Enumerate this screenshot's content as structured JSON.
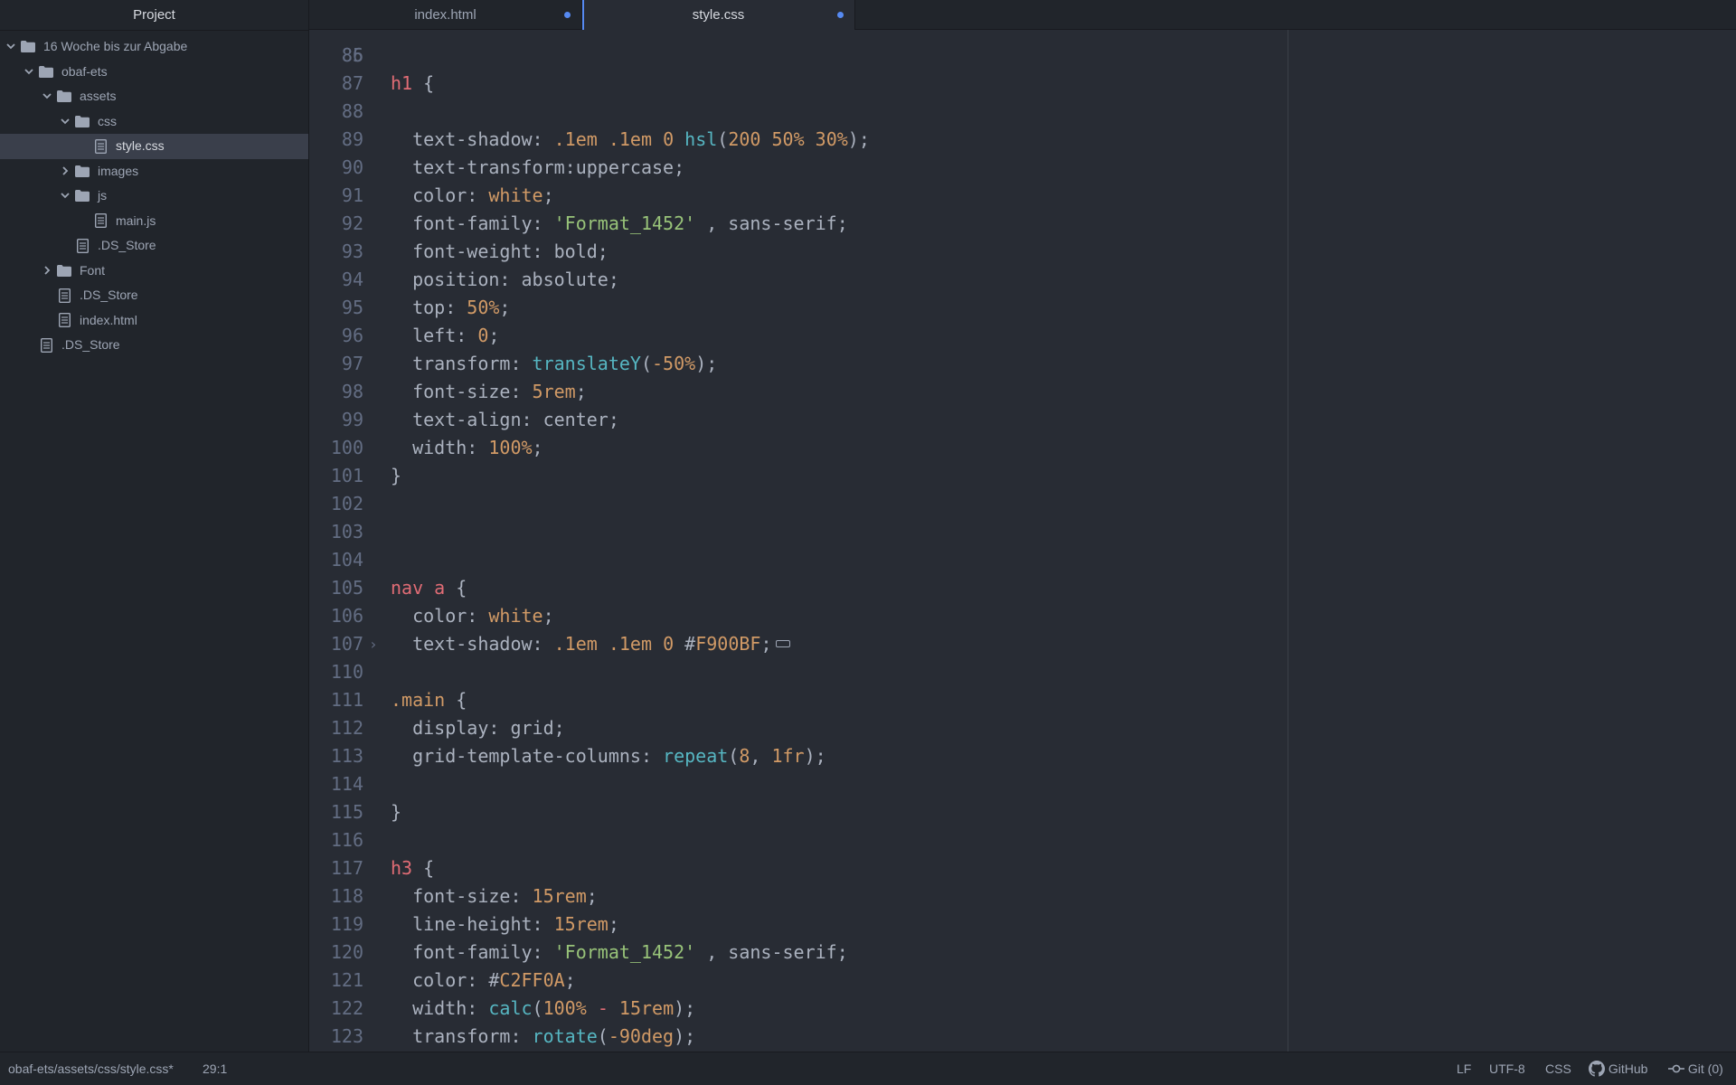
{
  "sidebar": {
    "title": "Project",
    "tree": [
      {
        "label": "16 Woche bis zur Abgabe",
        "type": "folder",
        "expanded": true,
        "depth": 0
      },
      {
        "label": "obaf-ets",
        "type": "folder",
        "expanded": true,
        "depth": 1
      },
      {
        "label": "assets",
        "type": "folder",
        "expanded": true,
        "depth": 2
      },
      {
        "label": "css",
        "type": "folder",
        "expanded": true,
        "depth": 3
      },
      {
        "label": "style.css",
        "type": "file",
        "depth": 4,
        "selected": true
      },
      {
        "label": "images",
        "type": "folder",
        "expanded": false,
        "depth": 3
      },
      {
        "label": "js",
        "type": "folder",
        "expanded": true,
        "depth": 3
      },
      {
        "label": "main.js",
        "type": "file",
        "depth": 4
      },
      {
        "label": ".DS_Store",
        "type": "file",
        "depth": 3
      },
      {
        "label": "Font",
        "type": "folder",
        "expanded": false,
        "depth": 2
      },
      {
        "label": ".DS_Store",
        "type": "file",
        "depth": 2
      },
      {
        "label": "index.html",
        "type": "file",
        "depth": 2
      },
      {
        "label": ".DS_Store",
        "type": "file",
        "depth": 1
      }
    ]
  },
  "tabs": [
    {
      "label": "index.html",
      "active": false,
      "modified": true
    },
    {
      "label": "style.css",
      "active": true,
      "modified": true
    }
  ],
  "editor": {
    "first_partial_line": "85",
    "lines": [
      {
        "n": "86",
        "tokens": []
      },
      {
        "n": "87",
        "tokens": [
          [
            "k",
            "h1"
          ],
          [
            "p",
            " {"
          ]
        ]
      },
      {
        "n": "88",
        "tokens": []
      },
      {
        "n": "89",
        "tokens": [
          [
            "p",
            "  text-shadow: "
          ],
          [
            "n",
            ".1em"
          ],
          [
            "p",
            " "
          ],
          [
            "n",
            ".1em"
          ],
          [
            "p",
            " "
          ],
          [
            "n",
            "0"
          ],
          [
            "p",
            " "
          ],
          [
            "f",
            "hsl"
          ],
          [
            "p",
            "("
          ],
          [
            "n",
            "200"
          ],
          [
            "p",
            " "
          ],
          [
            "n",
            "50%"
          ],
          [
            "p",
            " "
          ],
          [
            "n",
            "30%"
          ],
          [
            "p",
            ");"
          ]
        ]
      },
      {
        "n": "90",
        "tokens": [
          [
            "p",
            "  text-transform:uppercase;"
          ]
        ]
      },
      {
        "n": "91",
        "tokens": [
          [
            "p",
            "  color: "
          ],
          [
            "c",
            "white"
          ],
          [
            "p",
            ";"
          ]
        ]
      },
      {
        "n": "92",
        "tokens": [
          [
            "p",
            "  font-family: "
          ],
          [
            "s",
            "'Format_1452'"
          ],
          [
            "p",
            " , sans-serif;"
          ]
        ]
      },
      {
        "n": "93",
        "tokens": [
          [
            "p",
            "  font-weight: bold;"
          ]
        ]
      },
      {
        "n": "94",
        "tokens": [
          [
            "p",
            "  position: absolute;"
          ]
        ]
      },
      {
        "n": "95",
        "tokens": [
          [
            "p",
            "  top: "
          ],
          [
            "n",
            "50%"
          ],
          [
            "p",
            ";"
          ]
        ]
      },
      {
        "n": "96",
        "tokens": [
          [
            "p",
            "  left: "
          ],
          [
            "n",
            "0"
          ],
          [
            "p",
            ";"
          ]
        ]
      },
      {
        "n": "97",
        "tokens": [
          [
            "p",
            "  transform: "
          ],
          [
            "f",
            "translateY"
          ],
          [
            "p",
            "("
          ],
          [
            "n",
            "-50%"
          ],
          [
            "p",
            ");"
          ]
        ]
      },
      {
        "n": "98",
        "tokens": [
          [
            "p",
            "  font-size: "
          ],
          [
            "n",
            "5rem"
          ],
          [
            "p",
            ";"
          ]
        ]
      },
      {
        "n": "99",
        "tokens": [
          [
            "p",
            "  text-align: center;"
          ]
        ]
      },
      {
        "n": "100",
        "tokens": [
          [
            "p",
            "  width: "
          ],
          [
            "n",
            "100%"
          ],
          [
            "p",
            ";"
          ]
        ]
      },
      {
        "n": "101",
        "tokens": [
          [
            "p",
            "}"
          ]
        ]
      },
      {
        "n": "102",
        "tokens": []
      },
      {
        "n": "103",
        "tokens": []
      },
      {
        "n": "104",
        "tokens": []
      },
      {
        "n": "105",
        "tokens": [
          [
            "k",
            "nav"
          ],
          [
            "p",
            " "
          ],
          [
            "k",
            "a"
          ],
          [
            "p",
            " {"
          ]
        ]
      },
      {
        "n": "106",
        "tokens": [
          [
            "p",
            "  color: "
          ],
          [
            "c",
            "white"
          ],
          [
            "p",
            ";"
          ]
        ]
      },
      {
        "n": "107",
        "fold": true,
        "tokens": [
          [
            "p",
            "  text-shadow: "
          ],
          [
            "n",
            ".1em"
          ],
          [
            "p",
            " "
          ],
          [
            "n",
            ".1em"
          ],
          [
            "p",
            " "
          ],
          [
            "n",
            "0"
          ],
          [
            "p",
            " #"
          ],
          [
            "n",
            "F900BF"
          ],
          [
            "p",
            ";"
          ]
        ]
      },
      {
        "n": "110",
        "tokens": []
      },
      {
        "n": "111",
        "tokens": [
          [
            "c",
            ".main"
          ],
          [
            "p",
            " {"
          ]
        ]
      },
      {
        "n": "112",
        "tokens": [
          [
            "p",
            "  display: grid;"
          ]
        ]
      },
      {
        "n": "113",
        "tokens": [
          [
            "p",
            "  grid-template-columns: "
          ],
          [
            "f",
            "repeat"
          ],
          [
            "p",
            "("
          ],
          [
            "n",
            "8"
          ],
          [
            "p",
            ", "
          ],
          [
            "n",
            "1fr"
          ],
          [
            "p",
            ");"
          ]
        ]
      },
      {
        "n": "114",
        "tokens": []
      },
      {
        "n": "115",
        "tokens": [
          [
            "p",
            "}"
          ]
        ]
      },
      {
        "n": "116",
        "tokens": []
      },
      {
        "n": "117",
        "tokens": [
          [
            "k",
            "h3"
          ],
          [
            "p",
            " {"
          ]
        ]
      },
      {
        "n": "118",
        "tokens": [
          [
            "p",
            "  font-size: "
          ],
          [
            "n",
            "15rem"
          ],
          [
            "p",
            ";"
          ]
        ]
      },
      {
        "n": "119",
        "tokens": [
          [
            "p",
            "  line-height: "
          ],
          [
            "n",
            "15rem"
          ],
          [
            "p",
            ";"
          ]
        ]
      },
      {
        "n": "120",
        "tokens": [
          [
            "p",
            "  font-family: "
          ],
          [
            "s",
            "'Format_1452'"
          ],
          [
            "p",
            " , sans-serif;"
          ]
        ]
      },
      {
        "n": "121",
        "tokens": [
          [
            "p",
            "  color: #"
          ],
          [
            "n",
            "C2FF0A"
          ],
          [
            "p",
            ";"
          ]
        ]
      },
      {
        "n": "122",
        "tokens": [
          [
            "p",
            "  width: "
          ],
          [
            "f",
            "calc"
          ],
          [
            "p",
            "("
          ],
          [
            "n",
            "100%"
          ],
          [
            "p",
            " "
          ],
          [
            "k",
            "-"
          ],
          [
            "p",
            " "
          ],
          [
            "n",
            "15rem"
          ],
          [
            "p",
            ");"
          ]
        ]
      },
      {
        "n": "123",
        "tokens": [
          [
            "p",
            "  transform: "
          ],
          [
            "f",
            "rotate"
          ],
          [
            "p",
            "("
          ],
          [
            "n",
            "-90deg"
          ],
          [
            "p",
            ");"
          ]
        ]
      }
    ]
  },
  "statusbar": {
    "path": "obaf-ets/assets/css/style.css*",
    "cursor": "29:1",
    "line_ending": "LF",
    "encoding": "UTF-8",
    "grammar": "CSS",
    "github": "GitHub",
    "git": "Git (0)"
  },
  "colors": {
    "background": "#282c34",
    "panel": "#21252b",
    "accent": "#568af2",
    "keyword": "#e06c75",
    "number": "#d19a66",
    "function": "#56b6c2",
    "string": "#98c379"
  }
}
